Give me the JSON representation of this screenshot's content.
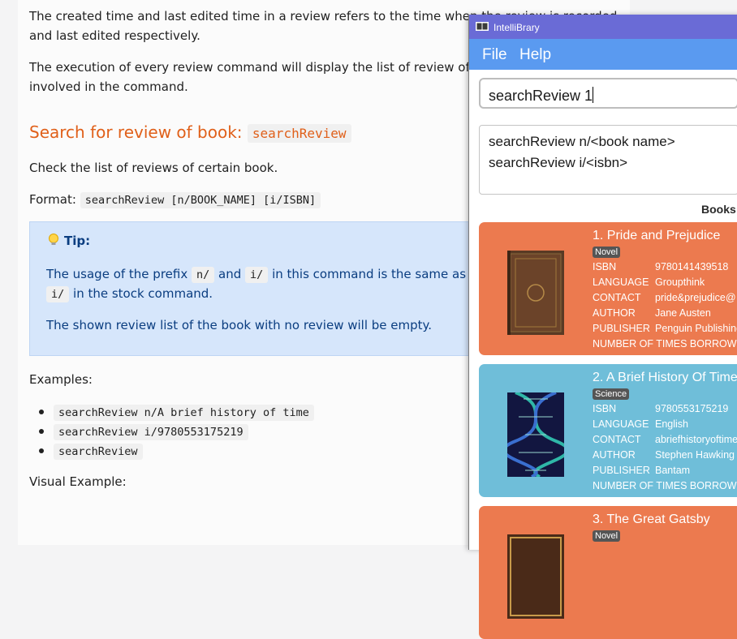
{
  "doc": {
    "para1_line1": "The created time and last edited time in a review refers to the time when the review is recorded",
    "para1_line2": "and last edited respectively.",
    "para2_line1": "The execution of every review command will display the list of review of the book",
    "para2_line2": "involved in the command.",
    "heading_text": "Search for review of book: ",
    "heading_code": "searchReview",
    "check_text": "Check the list of reviews of certain book.",
    "format_label": "Format: ",
    "format_code": "searchReview [n/BOOK_NAME] [i/ISBN]",
    "tip": {
      "title": "Tip:",
      "l1_a": "The usage of the prefix ",
      "l1_code1": "n/",
      "l1_b": " and ",
      "l1_code2": "i/",
      "l1_c": " in this command is the same as the usage of",
      "l2_code": "i/",
      "l2_a": " in the stock command.",
      "l3": "The shown review list of the book with no review will be empty."
    },
    "examples_label": "Examples:",
    "examples": [
      "searchReview n/A brief history of time",
      "searchReview i/9780553175219",
      "searchReview"
    ],
    "visual_label": "Visual Example:"
  },
  "app": {
    "window_title": "IntelliBrary",
    "menu": [
      "File",
      "Help"
    ],
    "command_value": "searchReview 1",
    "result_lines": [
      "searchReview n/<book name>",
      "searchReview i/<isbn>"
    ],
    "books_label": "Books",
    "field_labels": [
      "ISBN",
      "LANGUAGE",
      "CONTACT",
      "AUTHOR",
      "PUBLISHER",
      "NUMBER OF TIMES BORROWED"
    ],
    "books": [
      {
        "title": "1.  Pride and Prejudice",
        "genre": "Novel",
        "isbn": "9780141439518",
        "language": "Groupthink",
        "contact": "pride&prejudice@",
        "author": "Jane Austen",
        "publisher": "Penguin Publishing",
        "color": "#ec7a4f"
      },
      {
        "title": "2.  A Brief History Of Time",
        "genre": "Science",
        "isbn": "9780553175219",
        "language": "English",
        "contact": "abriefhistoryoftime",
        "author": "Stephen Hawking",
        "publisher": "Bantam",
        "color": "#6fbed9"
      },
      {
        "title": "3.  The Great Gatsby",
        "genre": "Novel",
        "color": "#ec7a4f"
      }
    ]
  }
}
